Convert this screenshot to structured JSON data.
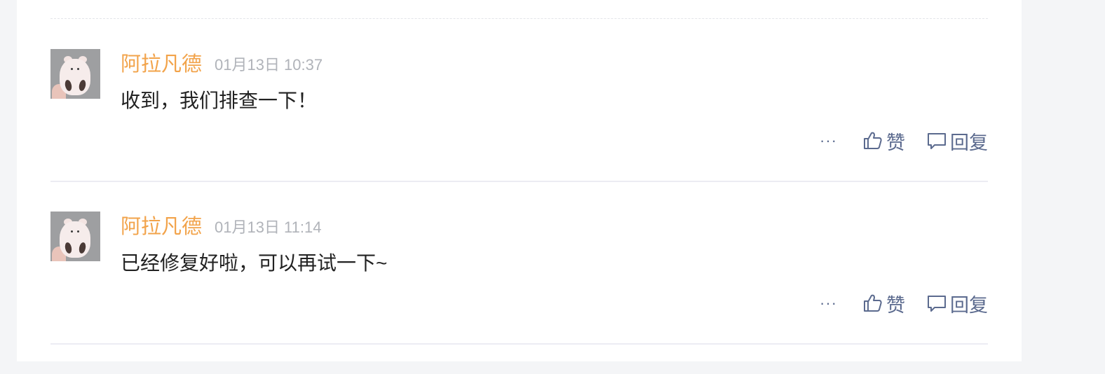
{
  "comments": [
    {
      "author": "阿拉凡德",
      "time": "01月13日 10:37",
      "content": "收到，我们排查一下！",
      "more_label": "···",
      "like_label": "赞",
      "reply_label": "回复"
    },
    {
      "author": "阿拉凡德",
      "time": "01月13日 11:14",
      "content": "已经修复好啦，可以再试一下~",
      "more_label": "···",
      "like_label": "赞",
      "reply_label": "回复"
    }
  ],
  "colors": {
    "author": "#f2a34a",
    "time": "#b0b3b9",
    "content": "#222222",
    "action": "#5b6a8e",
    "background": "#f4f5f7",
    "panel": "#ffffff"
  },
  "icons": {
    "like": "thumbs-up-icon",
    "reply": "comment-bubble-icon",
    "more": "ellipsis-icon"
  }
}
